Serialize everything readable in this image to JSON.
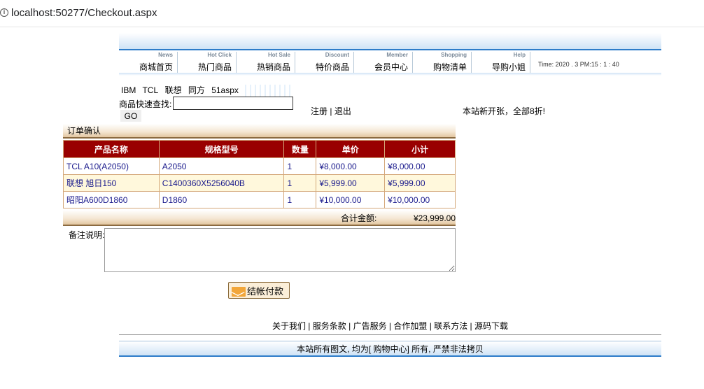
{
  "browser": {
    "url_host": "localhost",
    "url_rest": ":50277/Checkout.aspx"
  },
  "nav": [
    {
      "en": "News",
      "cn": "商城首页"
    },
    {
      "en": "Hot Click",
      "cn": "热门商品"
    },
    {
      "en": "Hot Sale",
      "cn": "热销商品"
    },
    {
      "en": "Discount",
      "cn": "特价商品"
    },
    {
      "en": "Member",
      "cn": "会员中心"
    },
    {
      "en": "Shopping",
      "cn": "购物清单"
    },
    {
      "en": "Help",
      "cn": "导购小姐"
    }
  ],
  "time_text": "Time:  2020 . 3  PM:15  :  1  :  40",
  "brands": [
    "IBM",
    "TCL",
    "联想",
    "同方",
    "51aspx"
  ],
  "search": {
    "label": "商品快速查找:",
    "value": "",
    "go": "GO"
  },
  "account": {
    "register": "注册",
    "sep": " | ",
    "logout": "退出"
  },
  "promo": "本站新开张，全部8折!",
  "order": {
    "title": "订单确认",
    "columns": [
      "产品名称",
      "规格型号",
      "数量",
      "单价",
      "小计"
    ],
    "rows": [
      {
        "name": "TCL A10(A2050)",
        "model": "A2050",
        "qty": "1",
        "price": "¥8,000.00",
        "subtotal": "¥8,000.00"
      },
      {
        "name": "联想 旭日150",
        "model": "C1400360X5256040B",
        "qty": "1",
        "price": "¥5,999.00",
        "subtotal": "¥5,999.00"
      },
      {
        "name": "昭阳A600D1860",
        "model": "D1860",
        "qty": "1",
        "price": "¥10,000.00",
        "subtotal": "¥10,000.00"
      }
    ],
    "total_label": "合计金额:",
    "total_value": "¥23,999.00"
  },
  "note": {
    "label": "备注说明:",
    "value": ""
  },
  "checkout_label": "结帐付款",
  "footer": {
    "links": [
      "关于我们",
      "服务条款",
      "广告服务",
      "合作加盟",
      "联系方法",
      "源码下载"
    ],
    "copyright": "本站所有图文, 均为[ 购物中心] 所有, 严禁非法拷贝"
  }
}
